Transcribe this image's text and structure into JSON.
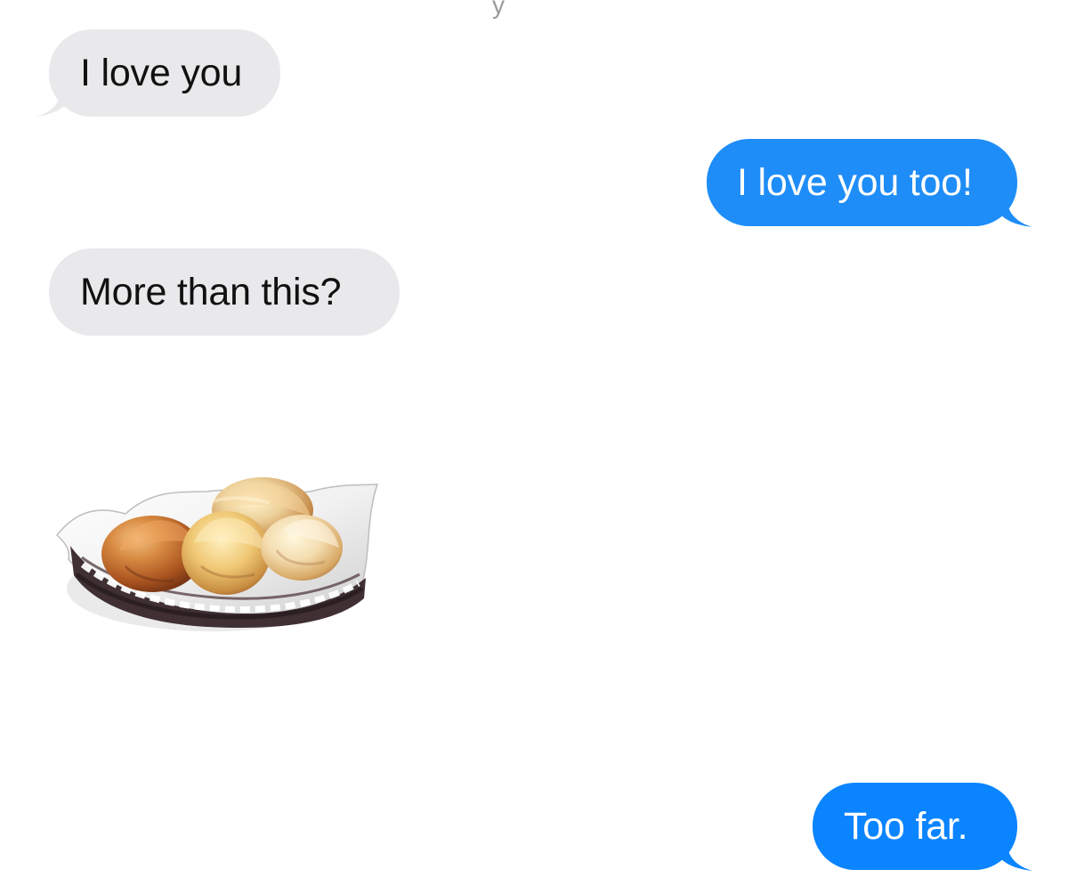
{
  "conversation": {
    "top_fragment": "y",
    "messages": [
      {
        "direction": "incoming",
        "text": "I love you"
      },
      {
        "direction": "outgoing",
        "text": "I love you too!"
      },
      {
        "direction": "incoming",
        "text": "More than this?"
      },
      {
        "direction": "incoming",
        "type": "image",
        "alt": "bread rolls in basket"
      },
      {
        "direction": "outgoing",
        "text": "Too far."
      }
    ]
  },
  "colors": {
    "incoming_bubble": "#e9e9eb",
    "outgoing_bubble": "#1f8df7",
    "outgoing_bubble_last": "#0b84ff",
    "text_dark": "#111111",
    "text_light": "#ffffff"
  }
}
